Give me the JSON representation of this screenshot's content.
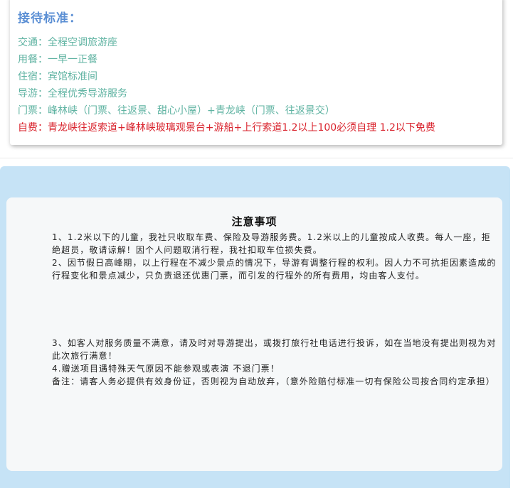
{
  "standards": {
    "title": "接待标准：",
    "items": [
      {
        "label": "交通：",
        "value": "全程空调旅游座"
      },
      {
        "label": "用餐：",
        "value": "一早一正餐"
      },
      {
        "label": "住宿：",
        "value": "宾馆标准间"
      },
      {
        "label": "导游：",
        "value": "全程优秀导游服务"
      },
      {
        "label": "门票：",
        "value": "峰林峡（门票、往返景、甜心小屋）+青龙峡（门票、往返景交）"
      },
      {
        "label": "自费：",
        "value": "青龙峡往返索道+峰林峡玻璃观景台+游船+上行索道1.2以上100必须自理 1.2以下免费"
      }
    ]
  },
  "notes": {
    "title": "注意事项",
    "paragraphs": [
      "1、1.2米以下的儿童，我社只收取车费、保险及导游服务费。1.2米以上的儿童按成人收费。每人一座，拒绝超员，敬请谅解！因个人问题取消行程，我社扣取车位损失费。",
      "2、因节假日高峰期，以上行程在不减少景点的情况下，导游有调整行程的权利。因人力不可抗拒因素造成的行程变化和景点减少，只负责退还优惠门票，而引发的行程外的所有费用，均由客人支付。",
      "3、如客人对服务质量不满意，请及时对导游提出，或拨打旅行社电话进行投诉，如在当地没有提出则视为对此次旅行满意！",
      "4.赠送项目遇特殊天气原因不能参观或表演 不退门票！",
      "备注：请客人务必提供有效身份证，否则视为自动放弃，（意外险赔付标准一切有保险公司按合同约定承担）"
    ]
  },
  "colors": {
    "title_blue": "#5b8fd4",
    "item_teal": "#5fb3a2",
    "self_pay_red": "#d9232d",
    "panel_blue": "#c6e3f6"
  }
}
